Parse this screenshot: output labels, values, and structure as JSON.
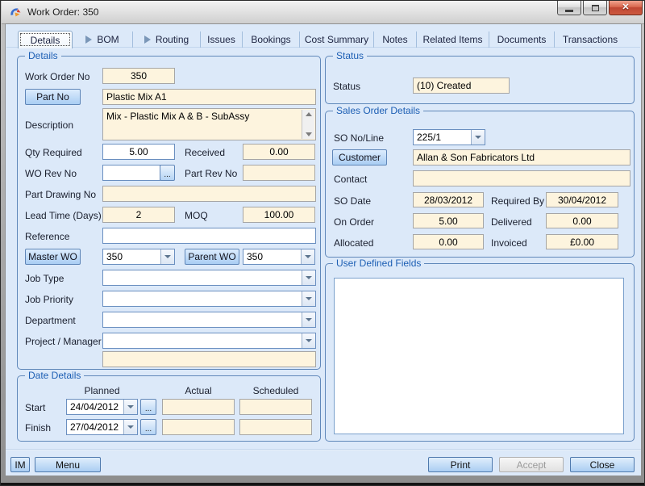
{
  "window": {
    "title": "Work Order: 350"
  },
  "icons": {
    "browse": "...",
    "close": "✕"
  },
  "tabs": {
    "items": [
      {
        "label": "Details"
      },
      {
        "label": "BOM"
      },
      {
        "label": "Routing"
      },
      {
        "label": "Issues"
      },
      {
        "label": "Bookings"
      },
      {
        "label": "Cost Summary"
      },
      {
        "label": "Notes"
      },
      {
        "label": "Related Items"
      },
      {
        "label": "Documents"
      },
      {
        "label": "Transactions"
      }
    ]
  },
  "details": {
    "title": "Details",
    "work_order_no": {
      "label": "Work Order No",
      "value": "350"
    },
    "part_no": {
      "button": "Part No",
      "value": "Plastic Mix A1"
    },
    "description": {
      "label": "Description",
      "value": "Mix - Plastic Mix A & B - SubAssy"
    },
    "qty_required": {
      "label": "Qty Required",
      "value": "5.00"
    },
    "received": {
      "label": "Received",
      "value": "0.00"
    },
    "wo_rev_no": {
      "label": "WO Rev No",
      "value": ""
    },
    "part_rev_no": {
      "label": "Part Rev No",
      "value": ""
    },
    "part_drawing_no": {
      "label": "Part Drawing No",
      "value": ""
    },
    "lead_time_days": {
      "label": "Lead Time (Days)",
      "value": "2"
    },
    "moq": {
      "label": "MOQ",
      "value": "100.00"
    },
    "reference": {
      "label": "Reference",
      "value": ""
    },
    "master_wo": {
      "button": "Master WO",
      "value": "350"
    },
    "parent_wo": {
      "button": "Parent WO",
      "value": "350"
    },
    "job_type": {
      "label": "Job Type",
      "value": ""
    },
    "job_priority": {
      "label": "Job Priority",
      "value": ""
    },
    "department": {
      "label": "Department",
      "value": ""
    },
    "project_manager": {
      "label": "Project / Manager",
      "value": ""
    },
    "unlabeled_value": ""
  },
  "date_details": {
    "title": "Date Details",
    "columns": [
      "Planned",
      "Actual",
      "Scheduled"
    ],
    "start": {
      "label": "Start",
      "planned": "24/04/2012",
      "actual": "",
      "scheduled": ""
    },
    "finish": {
      "label": "Finish",
      "planned": "27/04/2012",
      "actual": "",
      "scheduled": ""
    }
  },
  "status": {
    "title": "Status",
    "label": "Status",
    "value": "(10) Created"
  },
  "sales_order": {
    "title": "Sales Order Details",
    "so_no_line": {
      "label": "SO No/Line",
      "value": "225/1"
    },
    "customer": {
      "button": "Customer",
      "value": "Allan & Son Fabricators Ltd"
    },
    "contact": {
      "label": "Contact",
      "value": ""
    },
    "so_date": {
      "label": "SO Date",
      "value": "28/03/2012"
    },
    "required_by": {
      "label": "Required By",
      "value": "30/04/2012"
    },
    "on_order": {
      "label": "On Order",
      "value": "5.00"
    },
    "delivered": {
      "label": "Delivered",
      "value": "0.00"
    },
    "allocated": {
      "label": "Allocated",
      "value": "0.00"
    },
    "invoiced": {
      "label": "Invoiced",
      "value": "£0.00"
    }
  },
  "user_defined": {
    "title": "User Defined Fields"
  },
  "footer": {
    "im": "IM",
    "menu": "Menu",
    "print": "Print",
    "accept": "Accept",
    "close": "Close"
  },
  "colors": {
    "client_bg": "#dce9f9",
    "readonly_field_bg": "#fdf4de",
    "editable_field_border": "#6a8fc0",
    "group_border": "#6088ba",
    "group_title": "#1d5fb4",
    "button_gradient_bottom": "#aacdf2",
    "close_button_red": "#c04733"
  }
}
